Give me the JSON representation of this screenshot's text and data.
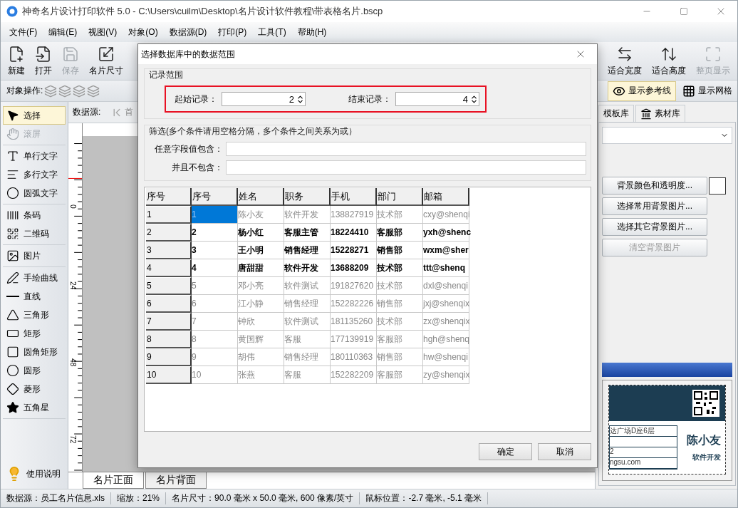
{
  "window": {
    "title": "神奇名片设计打印软件 5.0 - C:\\Users\\cuilm\\Desktop\\名片设计软件教程\\带表格名片.bscp"
  },
  "menu": [
    "文件(F)",
    "编辑(E)",
    "视图(V)",
    "对象(O)",
    "数据源(D)",
    "打印(P)",
    "工具(T)",
    "帮助(H)"
  ],
  "toolbar_left": [
    {
      "label": "新建",
      "kind": "new",
      "disabled": false
    },
    {
      "label": "打开",
      "kind": "open",
      "disabled": false
    },
    {
      "label": "保存",
      "kind": "save",
      "disabled": true
    },
    {
      "label": "名片尺寸",
      "kind": "size",
      "disabled": false
    }
  ],
  "toolbar_right": [
    {
      "label": "适合宽度",
      "kind": "fitwidth",
      "disabled": false
    },
    {
      "label": "适合高度",
      "kind": "fitheight",
      "disabled": false
    },
    {
      "label": "整页显示",
      "kind": "fitpage",
      "disabled": true
    }
  ],
  "object_ops": {
    "label": "对象操作:"
  },
  "view_toggles": [
    {
      "label": "显示参考线",
      "kind": "guides",
      "selected": true
    },
    {
      "label": "显示网格",
      "kind": "grid",
      "selected": false
    }
  ],
  "tools": [
    [
      {
        "label": "选择",
        "kind": "select",
        "selected": true,
        "disabled": false
      },
      {
        "label": "滚屏",
        "kind": "hand",
        "selected": false,
        "disabled": true
      }
    ],
    [
      {
        "label": "单行文字",
        "kind": "text",
        "selected": false,
        "disabled": false
      },
      {
        "label": "多行文字",
        "kind": "multitext",
        "selected": false,
        "disabled": false
      },
      {
        "label": "圆弧文字",
        "kind": "arctext",
        "selected": false,
        "disabled": false
      }
    ],
    [
      {
        "label": "条码",
        "kind": "barcode",
        "selected": false,
        "disabled": false
      },
      {
        "label": "二维码",
        "kind": "qrcode",
        "selected": false,
        "disabled": false
      }
    ],
    [
      {
        "label": "图片",
        "kind": "image",
        "selected": false,
        "disabled": false
      }
    ],
    [
      {
        "label": "手绘曲线",
        "kind": "pen",
        "selected": false,
        "disabled": false
      },
      {
        "label": "直线",
        "kind": "line",
        "selected": false,
        "disabled": false
      },
      {
        "label": "三角形",
        "kind": "triangle",
        "selected": false,
        "disabled": false
      },
      {
        "label": "矩形",
        "kind": "rect",
        "selected": false,
        "disabled": false
      },
      {
        "label": "圆角矩形",
        "kind": "roundrect",
        "selected": false,
        "disabled": false
      },
      {
        "label": "圆形",
        "kind": "ellipse",
        "selected": false,
        "disabled": false
      },
      {
        "label": "菱形",
        "kind": "diamond",
        "selected": false,
        "disabled": false
      },
      {
        "label": "五角星",
        "kind": "star",
        "selected": false,
        "disabled": false
      }
    ]
  ],
  "help": {
    "label": "使用说明"
  },
  "datasource_bar": {
    "label": "数据源:",
    "first_button": "首"
  },
  "ruler": {
    "labels": [
      "0",
      "24",
      "48",
      "72"
    ]
  },
  "page_tabs": [
    {
      "label": "名片正面",
      "selected": true
    },
    {
      "label": "名片背面",
      "selected": false
    }
  ],
  "right_panel": {
    "tabs": [
      {
        "label": "模板库",
        "selected": false
      },
      {
        "label": "素材库",
        "kind": "material",
        "selected": false
      }
    ],
    "buttons": [
      {
        "label": "背景颜色和透明度...",
        "disabled": false
      },
      {
        "label": "选择常用背景图片...",
        "disabled": false
      },
      {
        "label": "选择其它背景图片...",
        "disabled": false
      },
      {
        "label": "清空背景图片",
        "disabled": true
      }
    ],
    "swatch": {
      "color": "#ffffff"
    },
    "card": {
      "name": "陈小友",
      "title": "软件开发",
      "lines": [
        "达广场D座6层",
        "2",
        "ngsu.com"
      ]
    }
  },
  "status_bar": [
    "数据源：员工名片信息.xls",
    "缩放：21%",
    "名片尺寸：90.0 毫米 x 50.0 毫米, 600 像素/英寸",
    "鼠标位置：-2.7 毫米, -5.1 毫米"
  ],
  "dialog": {
    "title": "选择数据库中的数据范围",
    "range": {
      "legend": "记录范围",
      "highlighted": true,
      "start": {
        "label": "起始记录：",
        "value": "2"
      },
      "end": {
        "label": "结束记录：",
        "value": "4"
      }
    },
    "filter": {
      "legend": "筛选(多个条件请用空格分隔，多个条件之间关系为或）",
      "fields": [
        {
          "label": "任意字段值包含："
        },
        {
          "label": "并且不包含："
        }
      ]
    },
    "grid": {
      "columns": [
        "序号",
        "序号",
        "姓名",
        "职务",
        "手机",
        "部门",
        "邮箱"
      ],
      "rows": [
        {
          "cells": [
            "1",
            "1",
            "陈小友",
            "软件开发",
            "138827919",
            "技术部",
            "cxy@shenqi"
          ],
          "in_range": false,
          "focused": true
        },
        {
          "cells": [
            "2",
            "2",
            "杨小红",
            "客服主管",
            "18224410",
            "客服部",
            "yxh@shenc"
          ],
          "in_range": true,
          "focused": false
        },
        {
          "cells": [
            "3",
            "3",
            "王小明",
            "销售经理",
            "15228271",
            "销售部",
            "wxm@sher"
          ],
          "in_range": true,
          "focused": false
        },
        {
          "cells": [
            "4",
            "4",
            "唐甜甜",
            "软件开发",
            "13688209",
            "技术部",
            "ttt@shenq"
          ],
          "in_range": true,
          "focused": false
        },
        {
          "cells": [
            "5",
            "5",
            "邓小亮",
            "软件测试",
            "191827620",
            "技术部",
            "dxl@shenqi"
          ],
          "in_range": false,
          "focused": false
        },
        {
          "cells": [
            "6",
            "6",
            "江小静",
            "销售经理",
            "152282226",
            "销售部",
            "jxj@shenqix"
          ],
          "in_range": false,
          "focused": false
        },
        {
          "cells": [
            "7",
            "7",
            "钟欣",
            "软件测试",
            "181135260",
            "技术部",
            "zx@shenqix"
          ],
          "in_range": false,
          "focused": false
        },
        {
          "cells": [
            "8",
            "8",
            "黄国辉",
            "客服",
            "177139919",
            "客服部",
            "hgh@shenq"
          ],
          "in_range": false,
          "focused": false
        },
        {
          "cells": [
            "9",
            "9",
            "胡伟",
            "销售经理",
            "180110363",
            "销售部",
            "hw@shenqi"
          ],
          "in_range": false,
          "focused": false
        },
        {
          "cells": [
            "10",
            "10",
            "张燕",
            "客服",
            "152282209",
            "客服部",
            "zy@shenqix"
          ],
          "in_range": false,
          "focused": false
        }
      ]
    },
    "buttons": [
      "确定",
      "取消"
    ]
  }
}
